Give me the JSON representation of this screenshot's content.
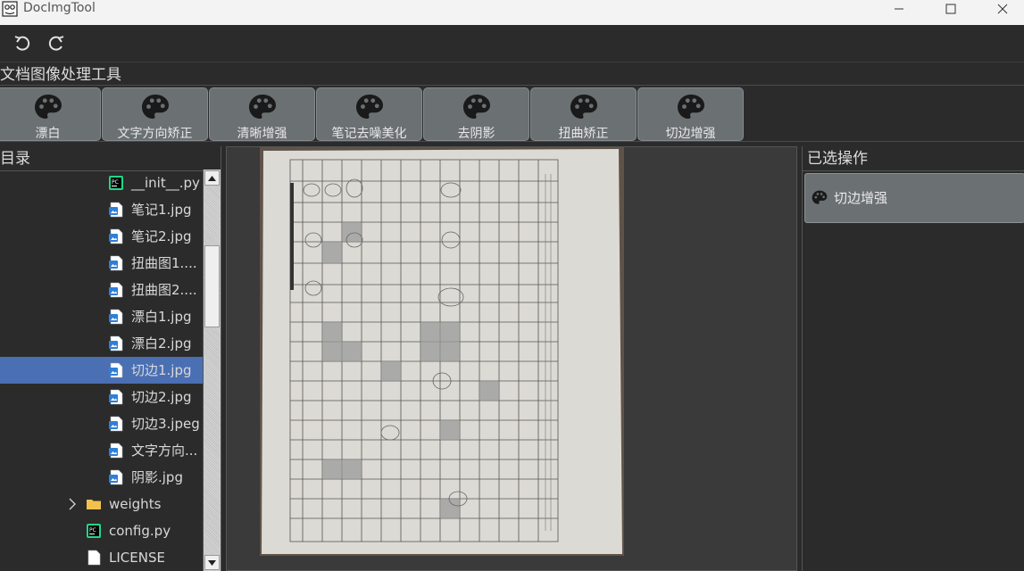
{
  "window": {
    "title": "DocImgTool",
    "buttons": [
      "minimize",
      "maximize",
      "close"
    ]
  },
  "toolbar": {
    "undo_icon": "undo-icon",
    "redo_icon": "redo-icon"
  },
  "operations": {
    "section_title": "文档图像处理工具",
    "icon": "palette-icon",
    "items": [
      {
        "label": "漂白"
      },
      {
        "label": "文字方向矫正"
      },
      {
        "label": "清晰增强"
      },
      {
        "label": "笔记去噪美化"
      },
      {
        "label": "去阴影"
      },
      {
        "label": "扭曲矫正"
      },
      {
        "label": "切边增强"
      }
    ]
  },
  "directory": {
    "title": "目录",
    "files": [
      {
        "name": "__init__.py",
        "icon": "pycharm-file-icon",
        "indent": 2,
        "selected": false
      },
      {
        "name": "笔记1.jpg",
        "icon": "image-file-icon",
        "indent": 2,
        "selected": false
      },
      {
        "name": "笔记2.jpg",
        "icon": "image-file-icon",
        "indent": 2,
        "selected": false
      },
      {
        "name": "扭曲图1....",
        "icon": "image-file-icon",
        "indent": 2,
        "selected": false
      },
      {
        "name": "扭曲图2....",
        "icon": "image-file-icon",
        "indent": 2,
        "selected": false
      },
      {
        "name": "漂白1.jpg",
        "icon": "image-file-icon",
        "indent": 2,
        "selected": false
      },
      {
        "name": "漂白2.jpg",
        "icon": "image-file-icon",
        "indent": 2,
        "selected": false
      },
      {
        "name": "切边1.jpg",
        "icon": "image-file-icon",
        "indent": 2,
        "selected": true
      },
      {
        "name": "切边2.jpg",
        "icon": "image-file-icon",
        "indent": 2,
        "selected": false
      },
      {
        "name": "切边3.jpeg",
        "icon": "image-file-icon",
        "indent": 2,
        "selected": false
      },
      {
        "name": "文字方向...",
        "icon": "image-file-icon",
        "indent": 2,
        "selected": false
      },
      {
        "name": "阴影.jpg",
        "icon": "image-file-icon",
        "indent": 2,
        "selected": false
      },
      {
        "name": "weights",
        "icon": "folder-icon",
        "indent": 1,
        "selected": false,
        "collapsed": true
      },
      {
        "name": "config.py",
        "icon": "pycharm-file-icon",
        "indent": 1,
        "selected": false
      },
      {
        "name": "LICENSE",
        "icon": "text-file-icon",
        "indent": 1,
        "selected": false
      }
    ]
  },
  "selected_ops": {
    "title": "已选操作",
    "items": [
      {
        "label": "切边增强",
        "icon": "palette-icon"
      }
    ]
  }
}
